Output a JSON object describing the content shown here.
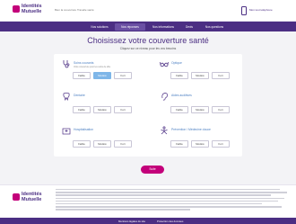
{
  "header": {
    "logo_line1": "Identités",
    "logo_line2": "Mutuelle",
    "tagline": "Bien la couverture Travelle santé",
    "phone_label": "Mon tout téléphone"
  },
  "nav": {
    "items": [
      {
        "label": "Nos solutions"
      },
      {
        "label": "Nos réponses"
      },
      {
        "label": "Nos informations"
      },
      {
        "label": "Devis"
      },
      {
        "label": "Nos questions"
      }
    ],
    "active_index": 1
  },
  "main": {
    "title": "Choisissez votre couverture santé",
    "subtitle": "Cliquez sur ce niveau pour les vos besoins",
    "submit_label": "Suite"
  },
  "categories": [
    {
      "label": "Soins courants",
      "desc": "Votre couverture pour les soins de ville",
      "options": [
        "Faible",
        "Modéré",
        "Fort"
      ],
      "selected": 1,
      "icon": "stethoscope-icon"
    },
    {
      "label": "Optique",
      "desc": "",
      "options": [
        "Faible",
        "Modéré",
        "Fort"
      ],
      "selected": -1,
      "icon": "glasses-icon"
    },
    {
      "label": "Dentaire",
      "desc": "",
      "options": [
        "Faible",
        "Modéré",
        "Fort"
      ],
      "selected": -1,
      "icon": "tooth-icon"
    },
    {
      "label": "Aides auditives",
      "desc": "",
      "options": [
        "Faible",
        "Modéré",
        "Fort"
      ],
      "selected": -1,
      "icon": "ear-icon"
    },
    {
      "label": "Hospitalisation",
      "desc": "",
      "options": [
        "Faible",
        "Modéré",
        "Fort"
      ],
      "selected": -1,
      "icon": "hospital-icon"
    },
    {
      "label": "Prévention / Médecine douce",
      "desc": "",
      "options": [
        "Faible",
        "Modéré",
        "Fort"
      ],
      "selected": -1,
      "icon": "yoga-icon"
    }
  ],
  "footer": {
    "logo_line1": "Identités",
    "logo_line2": "Mutuelle",
    "links": [
      "Mentions légales du site",
      "Protection des données"
    ]
  },
  "colors": {
    "brand_purple": "#4b2e83",
    "accent_magenta": "#c3007a",
    "selected_blue": "#7eb6e8",
    "label_blue": "#4b7fc2"
  }
}
